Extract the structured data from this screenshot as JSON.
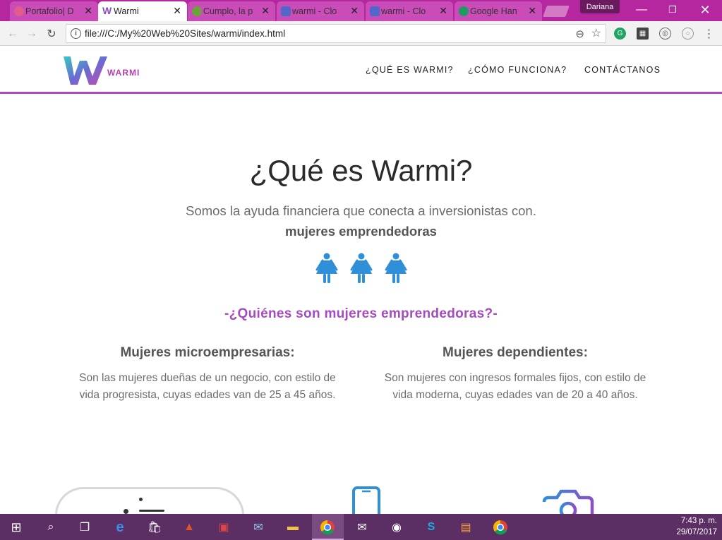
{
  "browser": {
    "tabs": [
      {
        "title": "Portafolio| D",
        "color": "#e25c8a"
      },
      {
        "title": "Warmi",
        "color": "#8b4fc7"
      },
      {
        "title": "Cumplo, la p",
        "color": "#6aa43a"
      },
      {
        "title": "warmi - Clo",
        "color": "#5267c9"
      },
      {
        "title": "warmi - Clo",
        "color": "#5267c9"
      },
      {
        "title": "Google Han",
        "color": "#1e9b62"
      }
    ],
    "profile_name": "Dariana",
    "url": "file:///C:/My%20Web%20Sites/warmi/index.html"
  },
  "site": {
    "logo_text": "WARMI",
    "nav": [
      "¿QUÉ ES WARMI?",
      "¿CÓMO FUNCIONA?",
      "CONTÁCTANOS"
    ],
    "hero_title": "¿Qué es Warmi?",
    "hero_lead": "Somos la ayuda financiera que conecta a inversionistas con.",
    "hero_strong": "mujeres emprendedoras",
    "section_title": "-¿Quiénes son mujeres emprendedoras?-",
    "columns": [
      {
        "title": "Mujeres microempresarias:",
        "line1": "Son las mujeres dueñas de un negocio, con estilo de",
        "line2": "vida progresista, cuyas edades van de 25 a 45 años."
      },
      {
        "title": "Mujeres dependientes:",
        "line1": "Son mujeres con ingresos formales fijos, con estilo de",
        "line2": "vida moderna, cuyas edades van de 20 a 40 años."
      }
    ]
  },
  "taskbar": {
    "time": "7:43 p. m.",
    "date": "29/07/2017"
  },
  "colors": {
    "accent": "#a94bc0",
    "icon_blue": "#2f8fd8",
    "tabstrip": "#b4279f",
    "taskbar": "#5b2f63"
  }
}
